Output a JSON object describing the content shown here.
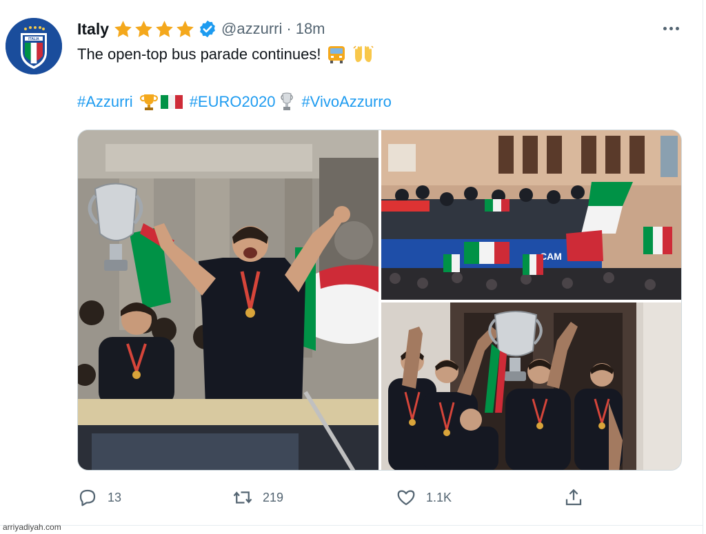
{
  "account": {
    "name": "Italy",
    "handle": "@azzurri",
    "separator": "·",
    "time": "18m",
    "avatar_icon": "figc-italy-crest-icon",
    "verified_icon": "verified-badge-icon",
    "stars_icon": "star-icon",
    "star_count": 4
  },
  "tweet": {
    "text": "The open-top bus parade continues!",
    "emojis": [
      "bus-icon",
      "raised-hands-icon"
    ],
    "hashtags": [
      {
        "tag": "#Azzurri",
        "emojis": [
          "trophy-icon",
          "italy-flag-icon"
        ]
      },
      {
        "tag": "#EURO2020",
        "emojis": [
          "euro-trophy-icon"
        ]
      },
      {
        "tag": "#VivoAzzurro",
        "emojis": []
      }
    ]
  },
  "media": [
    {
      "name": "photo-players-with-trophy-on-bus"
    },
    {
      "name": "photo-crowd-with-flags-at-bus"
    },
    {
      "name": "photo-players-lifting-trophy"
    }
  ],
  "actions": {
    "reply": {
      "icon": "reply-icon",
      "count": "13"
    },
    "retweet": {
      "icon": "retweet-icon",
      "count": "219"
    },
    "like": {
      "icon": "heart-icon",
      "count": "1.1K"
    },
    "share": {
      "icon": "share-icon"
    }
  },
  "more_icon": "more-options-icon",
  "watermark": "arriyadiyah.com",
  "colors": {
    "link": "#1d9bf0",
    "text": "#0f1419",
    "muted": "#536471",
    "star": "#f4a81c",
    "verified": "#1d9bf0"
  }
}
